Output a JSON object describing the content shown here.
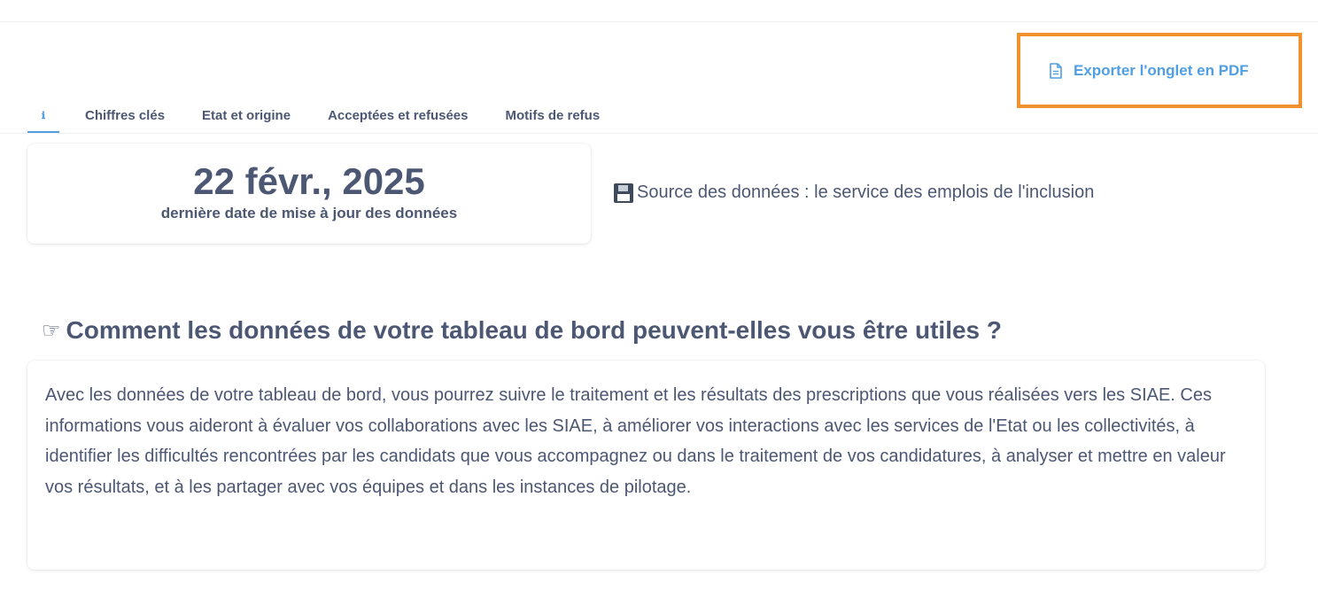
{
  "toolbar": {
    "export_label": "Exporter l'onglet en PDF"
  },
  "tabs": [
    {
      "label": "ℹ",
      "active": true
    },
    {
      "label": "Chiffres clés"
    },
    {
      "label": "Etat et origine"
    },
    {
      "label": "Acceptées et refusées"
    },
    {
      "label": "Motifs de refus"
    }
  ],
  "date_card": {
    "value": "22 févr., 2025",
    "label": "dernière date de mise à jour des données"
  },
  "source": {
    "icon": "floppy-disk-icon",
    "text": "Source des données : le service des emplois de l'inclusion"
  },
  "section": {
    "icon": "pointing-hand-icon",
    "title": "Comment les données de votre tableau de bord peuvent-elles vous être utiles ?",
    "body": "Avec les données de votre tableau de bord, vous pourrez suivre le traitement et les résultats des prescriptions que vous réalisées vers les SIAE. Ces informations vous aideront à évaluer vos collaborations avec les SIAE, à améliorer vos interactions avec les services de l'Etat ou les collectivités, à identifier les difficultés rencontrées par les candidats que vous accompagnez ou dans le traitement de vos candidatures, à analyser et mettre en valeur vos résultats, et à les partager avec vos équipes et dans les instances de pilotage."
  },
  "colors": {
    "accent": "#509ee3",
    "highlight_border": "#f0922e",
    "text": "#4c5773"
  }
}
